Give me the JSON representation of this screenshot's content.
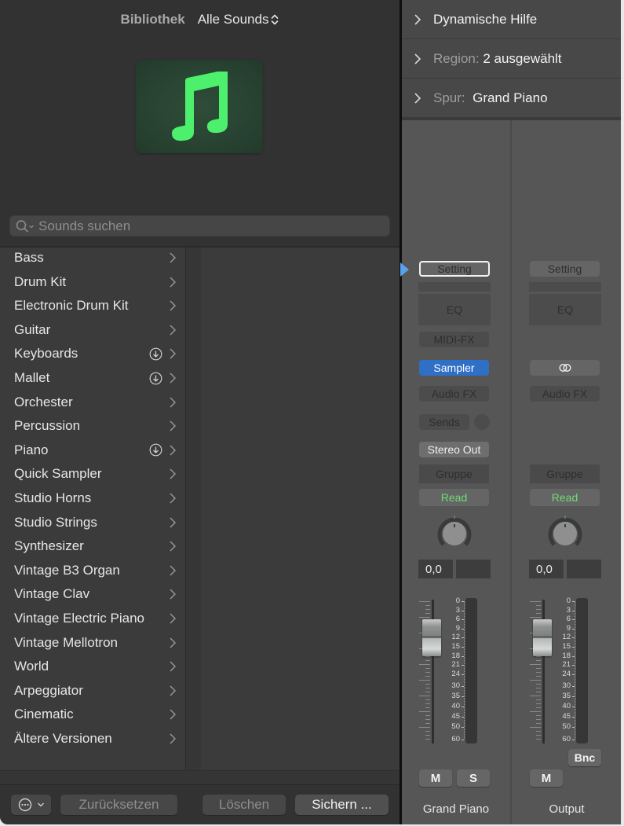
{
  "library": {
    "title": "Bibliothek",
    "filter": "Alle Sounds",
    "patch_icon": "music-note-icon",
    "search": {
      "placeholder": "Sounds suchen",
      "value": ""
    },
    "categories": [
      {
        "label": "Bass",
        "download": false
      },
      {
        "label": "Drum Kit",
        "download": false
      },
      {
        "label": "Electronic Drum Kit",
        "download": false
      },
      {
        "label": "Guitar",
        "download": false
      },
      {
        "label": "Keyboards",
        "download": true
      },
      {
        "label": "Mallet",
        "download": true
      },
      {
        "label": "Orchester",
        "download": false
      },
      {
        "label": "Percussion",
        "download": false
      },
      {
        "label": "Piano",
        "download": true
      },
      {
        "label": "Quick Sampler",
        "download": false
      },
      {
        "label": "Studio Horns",
        "download": false
      },
      {
        "label": "Studio Strings",
        "download": false
      },
      {
        "label": "Synthesizer",
        "download": false
      },
      {
        "label": "Vintage B3 Organ",
        "download": false
      },
      {
        "label": "Vintage Clav",
        "download": false
      },
      {
        "label": "Vintage Electric Piano",
        "download": false
      },
      {
        "label": "Vintage Mellotron",
        "download": false
      },
      {
        "label": "World",
        "download": false
      },
      {
        "label": "Arpeggiator",
        "download": false
      },
      {
        "label": "Cinematic",
        "download": false
      },
      {
        "label": "Ältere Versionen",
        "download": false
      }
    ],
    "footer": {
      "more_icon": "ellipsis-circle-icon",
      "reset": "Zurücksetzen",
      "delete": "Löschen",
      "save": "Sichern ..."
    }
  },
  "inspector": {
    "sections": [
      {
        "key": "",
        "value": "Dynamische Hilfe"
      },
      {
        "key": "Region:",
        "value": "2 ausgewählt"
      },
      {
        "key": "Spur:",
        "value": "Grand Piano"
      }
    ],
    "strips": [
      {
        "name": "Grand Piano",
        "setting": "Setting",
        "eq": "EQ",
        "midi_fx": "MIDI-FX",
        "instrument": "Sampler",
        "audio_fx": "Audio FX",
        "sends": "Sends",
        "output": "Stereo Out",
        "group": "Gruppe",
        "automation": "Read",
        "pan": 0,
        "volume": "0,0",
        "peak": "",
        "fader_db": 0,
        "mute": "M",
        "solo": "S"
      },
      {
        "name": "Output",
        "setting": "Setting",
        "eq": "EQ",
        "link_icon": "stereo-link-icon",
        "audio_fx": "Audio FX",
        "group": "Gruppe",
        "automation": "Read",
        "pan": 0,
        "volume": "0,0",
        "peak": "",
        "fader_db": 0,
        "bounce": "Bnc",
        "mute": "M"
      }
    ],
    "meter_scale": [
      "0",
      "3",
      "6",
      "9",
      "12",
      "15",
      "18",
      "21",
      "24",
      "30",
      "35",
      "40",
      "45",
      "50",
      "60"
    ]
  },
  "colors": {
    "accent_blue": "#2f6fc6",
    "read_green": "#6ddd72",
    "patch_green": "#4cf06c"
  }
}
